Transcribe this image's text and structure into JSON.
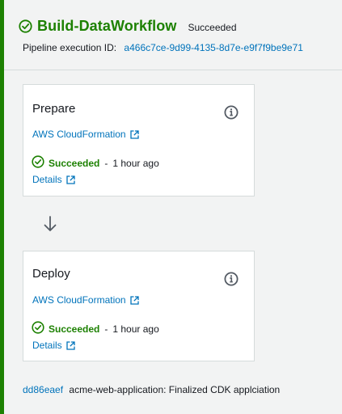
{
  "colors": {
    "success": "#1d8102",
    "link": "#0073bb",
    "text": "#16191f",
    "border": "#d5dbdb",
    "background": "#f2f3f3"
  },
  "stage": {
    "name": "Build-DataWorkflow",
    "status": "Succeeded",
    "status_icon": "check-circle-icon",
    "execution_label": "Pipeline execution ID:",
    "execution_id": "a466c7ce-9d99-4135-8d7e-e9f7f9be9e71"
  },
  "actions": [
    {
      "name": "Prepare",
      "provider": "AWS CloudFormation",
      "status": "Succeeded",
      "separator": "-",
      "time": "1 hour ago",
      "details_label": "Details",
      "info_icon": "info-icon"
    },
    {
      "name": "Deploy",
      "provider": "AWS CloudFormation",
      "status": "Succeeded",
      "separator": "-",
      "time": "1 hour ago",
      "details_label": "Details",
      "info_icon": "info-icon"
    }
  ],
  "transition_icon": "arrow-down-icon",
  "commit": {
    "id": "dd86eaef",
    "message": "acme-web-application: Finalized CDK applciation"
  }
}
